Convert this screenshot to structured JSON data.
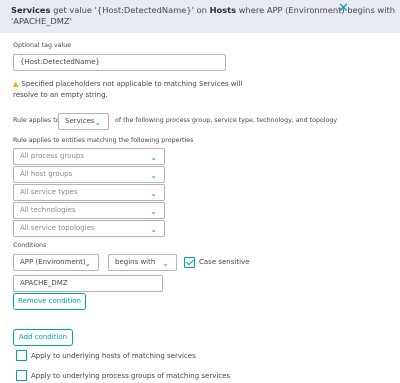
{
  "header": {
    "part1": "Services",
    "part2": " get value '{Host:DetectedName}' on ",
    "part3": "Hosts",
    "part4": " where APP (Environment) begins with 'APACHE_DMZ'",
    "close_icon": "close-icon"
  },
  "tag_value": {
    "label": "Optional tag value",
    "value": "{Host:DetectedName}"
  },
  "warning": {
    "icon": "warning-icon",
    "text": "Specified placeholders not applicable to matching Services will resolve to an empty string."
  },
  "rule_applies": {
    "label": "Rule applies to",
    "selected": "Services",
    "suffix": "of the following process group, service type, technology, and topology"
  },
  "entities": {
    "label": "Rule applies to entities matching the following properties",
    "dropdowns": [
      "All process groups",
      "All host groups",
      "All service types",
      "All technologies",
      "All service topologies"
    ]
  },
  "conditions": {
    "label": "Conditions",
    "attribute": "APP (Environment)",
    "operator": "begins with",
    "case_sensitive_label": "Case sensitive",
    "case_sensitive_checked": true,
    "value": "APACHE_DMZ",
    "remove_label": "Remove condition"
  },
  "add_condition_label": "Add condition",
  "options": [
    {
      "label": "Apply to underlying hosts of matching services",
      "checked": false
    },
    {
      "label": "Apply to underlying process groups of matching services",
      "checked": false
    }
  ]
}
